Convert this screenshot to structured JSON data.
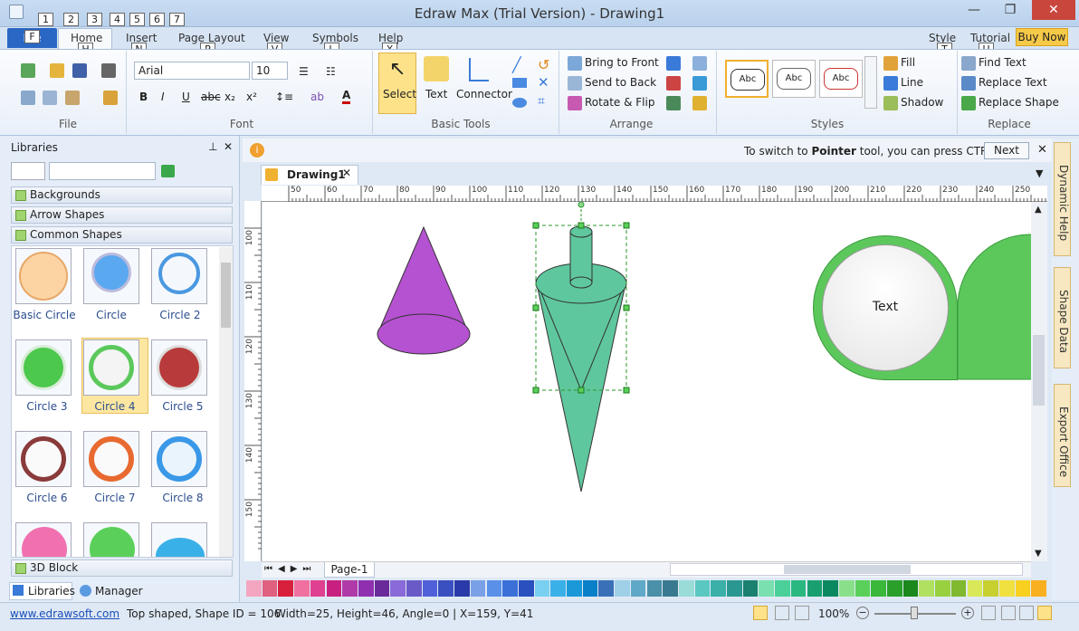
{
  "window": {
    "title": "Edraw Max (Trial Version) - Drawing1"
  },
  "quick_access_keys": [
    "1",
    "2",
    "3",
    "4",
    "5",
    "6",
    "7"
  ],
  "menu": {
    "file": "File",
    "file_key": "F",
    "tabs": [
      {
        "label": "Home",
        "key": "H"
      },
      {
        "label": "Insert",
        "key": "N"
      },
      {
        "label": "Page Layout",
        "key": "P"
      },
      {
        "label": "View",
        "key": "V"
      },
      {
        "label": "Symbols",
        "key": "L"
      },
      {
        "label": "Help",
        "key": "X"
      }
    ],
    "right": {
      "style": "Style",
      "style_key": "T",
      "tutorial": "Tutorial",
      "tutorial_key": "U",
      "buy": "Buy Now"
    }
  },
  "ribbon": {
    "file_group": "File",
    "font_group": {
      "label": "Font",
      "font": "Arial",
      "size": "10"
    },
    "tools_group": {
      "label": "Basic Tools",
      "select": "Select",
      "text": "Text",
      "connector": "Connector"
    },
    "arrange_group": {
      "label": "Arrange",
      "bring_front": "Bring to Front",
      "send_back": "Send to Back",
      "rotate_flip": "Rotate & Flip"
    },
    "styles_group": {
      "label": "Styles",
      "samples": [
        "Abc",
        "Abc",
        "Abc"
      ],
      "fill": "Fill",
      "line": "Line",
      "shadow": "Shadow"
    },
    "replace_group": {
      "label": "Replace",
      "find_text": "Find Text",
      "replace_text": "Replace Text",
      "replace_shape": "Replace Shape"
    }
  },
  "info": {
    "message_pre": "To switch to ",
    "message_bold": "Pointer",
    "message_post": " tool, you can press CTRL+1.",
    "next": "Next"
  },
  "libraries": {
    "title": "Libraries",
    "categories": [
      "Backgrounds",
      "Arrow Shapes",
      "Common Shapes"
    ],
    "shapes": [
      {
        "label": "Basic Circle"
      },
      {
        "label": "Circle"
      },
      {
        "label": "Circle 2"
      },
      {
        "label": "Circle 3"
      },
      {
        "label": "Circle 4"
      },
      {
        "label": "Circle 5"
      },
      {
        "label": "Circle 6"
      },
      {
        "label": "Circle 7"
      },
      {
        "label": "Circle 8"
      }
    ],
    "bottom_category": "3D Block",
    "tabs": {
      "libraries": "Libraries",
      "manager": "Manager"
    }
  },
  "document": {
    "tab": "Drawing1",
    "page": "Page-1",
    "callout_text": "Text",
    "ruler_ticks": [
      "50",
      "60",
      "70",
      "80",
      "90",
      "100",
      "110",
      "120",
      "130",
      "140",
      "150",
      "160",
      "170",
      "180",
      "190",
      "200",
      "210",
      "220",
      "230",
      "240",
      "250"
    ],
    "vruler_ticks": [
      "100",
      "110",
      "120",
      "130",
      "140",
      "150"
    ]
  },
  "dock": {
    "dynamic_help": "Dynamic Help",
    "shape_data": "Shape Data",
    "export_office": "Export Office"
  },
  "status": {
    "link": "www.edrawsoft.com",
    "shape_info": "Top shaped, Shape ID = 106",
    "geometry": "Width=25, Height=46, Angle=0 | X=159, Y=41",
    "zoom": "100%"
  },
  "colors": {
    "accent": "#2a67c4",
    "cone_purple": "#b552d1",
    "cone_green": "#5fc79d",
    "callout_green": "#5cc85c"
  }
}
